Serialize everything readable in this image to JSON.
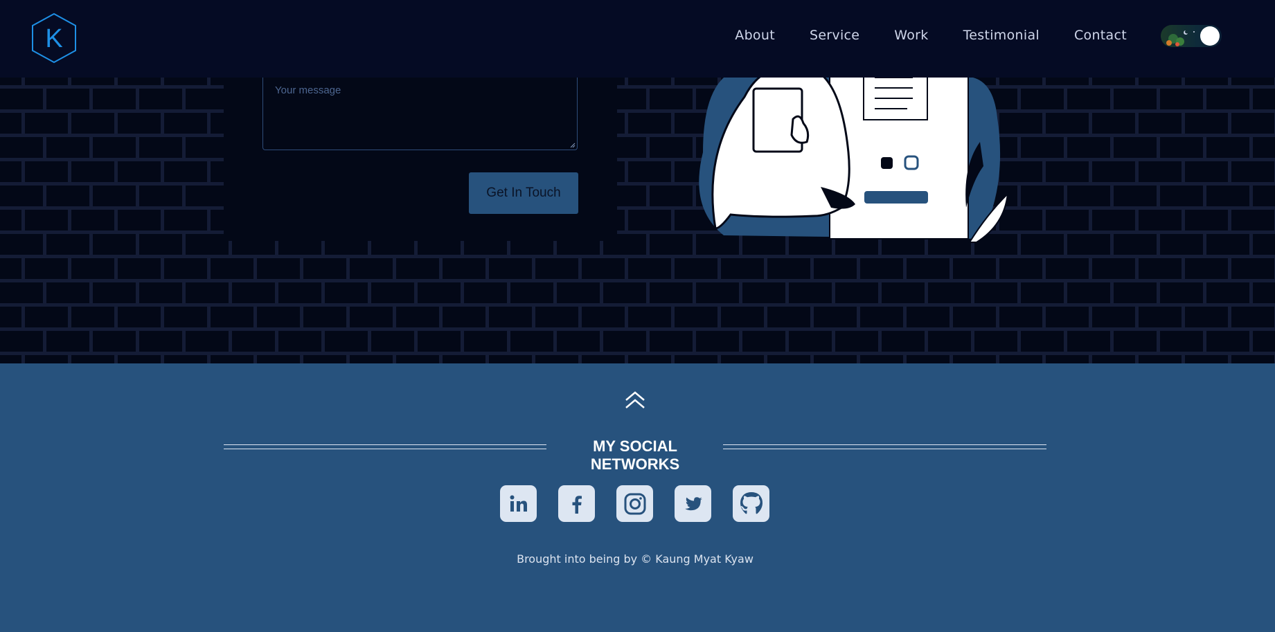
{
  "header": {
    "logo_letter": "K",
    "nav": [
      "About",
      "Service",
      "Work",
      "Testimonial",
      "Contact"
    ],
    "theme_toggle": {
      "state": "on",
      "icon": "night-scene-toggle"
    }
  },
  "contact_form": {
    "message_placeholder": "Your message",
    "submit_label": "Get In Touch"
  },
  "footer": {
    "scroll_top_icon": "double-chevron-up-icon",
    "social_title": "MY SOCIAL NETWORKS",
    "socials": [
      "linkedin-icon",
      "facebook-icon",
      "instagram-icon",
      "twitter-icon",
      "github-icon"
    ],
    "credit": "Brought into being by © Kaung Myat Kyaw"
  },
  "colors": {
    "header_bg": "#050b24",
    "page_bg": "#030817",
    "brick_mortar": "#141c36",
    "accent": "#27527d",
    "logo": "#1e90e6"
  }
}
